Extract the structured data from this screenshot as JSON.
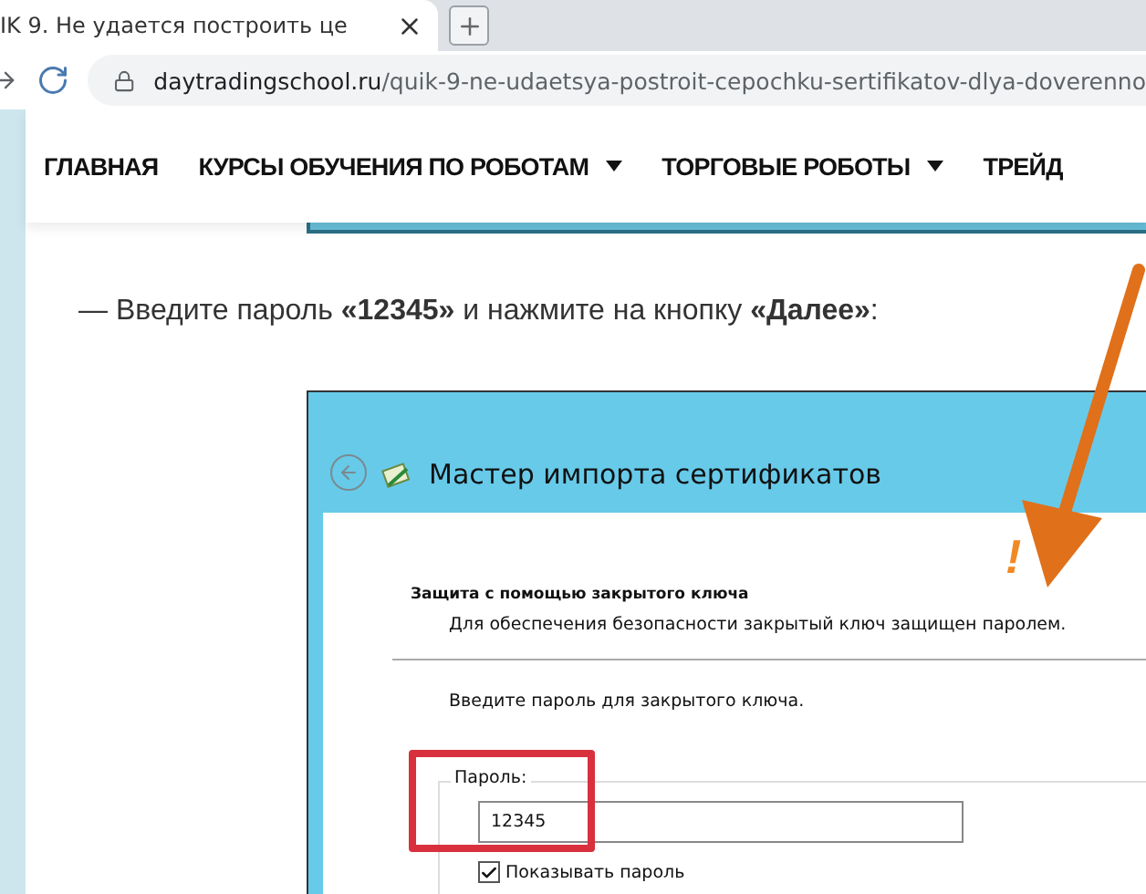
{
  "browser": {
    "tab": {
      "title": "IK 9. Не удается построить це",
      "selected": true
    },
    "address": {
      "domain": "daytradingschool.ru",
      "path": "/quik-9-ne-udaetsya-postroit-cepochku-sertifikatov-dlya-doverenno"
    }
  },
  "nav": [
    {
      "label": "ГЛАВНАЯ",
      "dropdown": false
    },
    {
      "label": "КУРСЫ ОБУЧЕНИЯ ПО РОБОТАМ",
      "dropdown": true
    },
    {
      "label": "ТОРГОВЫЕ РОБОТЫ",
      "dropdown": true
    },
    {
      "label": "ТРЕЙД",
      "dropdown": false
    }
  ],
  "instruction": "— Введите пароль **«12345»** и нажмите на кнопку **«Далее»**:",
  "wizard": {
    "title": "Мастер импорта сертификатов",
    "section_title": "Защита с помощью закрытого ключа",
    "section_description": "Для обеспечения безопасности закрытый ключ защищен паролем.",
    "prompt": "Введите пароль для закрытого ключа.",
    "password_group": {
      "label": "Пароль:",
      "value": "12345"
    },
    "show_password": {
      "label": "Показывать пароль",
      "checked": true
    }
  },
  "annotation": {
    "mark": "!"
  }
}
